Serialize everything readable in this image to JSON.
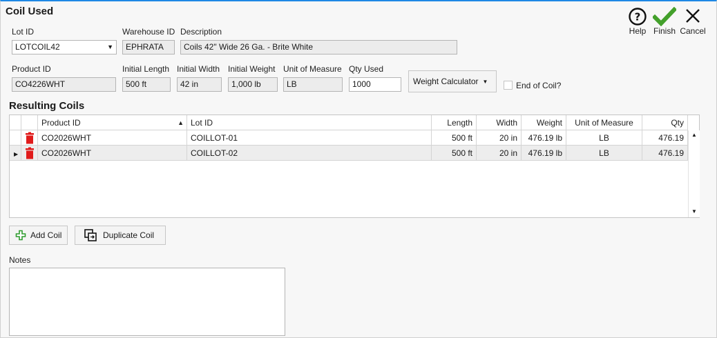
{
  "dialog": {
    "title": "Coil Used"
  },
  "toolbar": {
    "help_label": "Help",
    "finish_label": "Finish",
    "cancel_label": "Cancel"
  },
  "fields": {
    "lot_id": {
      "label": "Lot ID",
      "value": "LOTCOIL42"
    },
    "warehouse_id": {
      "label": "Warehouse ID",
      "value": "EPHRATA"
    },
    "description": {
      "label": "Description",
      "value": "Coils 42\" Wide 26 Ga. - Brite White"
    },
    "product_id": {
      "label": "Product ID",
      "value": "CO4226WHT"
    },
    "initial_length": {
      "label": "Initial Length",
      "value": "500 ft"
    },
    "initial_width": {
      "label": "Initial Width",
      "value": "42 in"
    },
    "initial_weight": {
      "label": "Initial Weight",
      "value": "1,000 lb"
    },
    "unit_of_measure": {
      "label": "Unit of Measure",
      "value": "LB"
    },
    "qty_used": {
      "label": "Qty Used",
      "value": "1000"
    }
  },
  "weight_calculator": {
    "label": "Weight Calculator"
  },
  "end_of_coil": {
    "label": "End of Coil?",
    "checked": false
  },
  "resulting_coils": {
    "title": "Resulting Coils",
    "columns": [
      "Product ID",
      "Lot ID",
      "Length",
      "Width",
      "Weight",
      "Unit of Measure",
      "Qty"
    ],
    "rows": [
      {
        "product_id": "CO2026WHT",
        "lot_id": "COILLOT-01",
        "length": "500 ft",
        "width": "20 in",
        "weight": "476.19 lb",
        "uom": "LB",
        "qty": "476.19"
      },
      {
        "product_id": "CO2026WHT",
        "lot_id": "COILLOT-02",
        "length": "500 ft",
        "width": "20 in",
        "weight": "476.19 lb",
        "uom": "LB",
        "qty": "476.19"
      }
    ]
  },
  "actions": {
    "add_coil_label": "Add Coil",
    "duplicate_coil_label": "Duplicate Coil"
  },
  "notes": {
    "label": "Notes",
    "value": ""
  },
  "colors": {
    "accent": "#1e88e5",
    "finish_green": "#43a02b",
    "delete_red": "#e01b1b",
    "add_green": "#2e9b2e"
  }
}
